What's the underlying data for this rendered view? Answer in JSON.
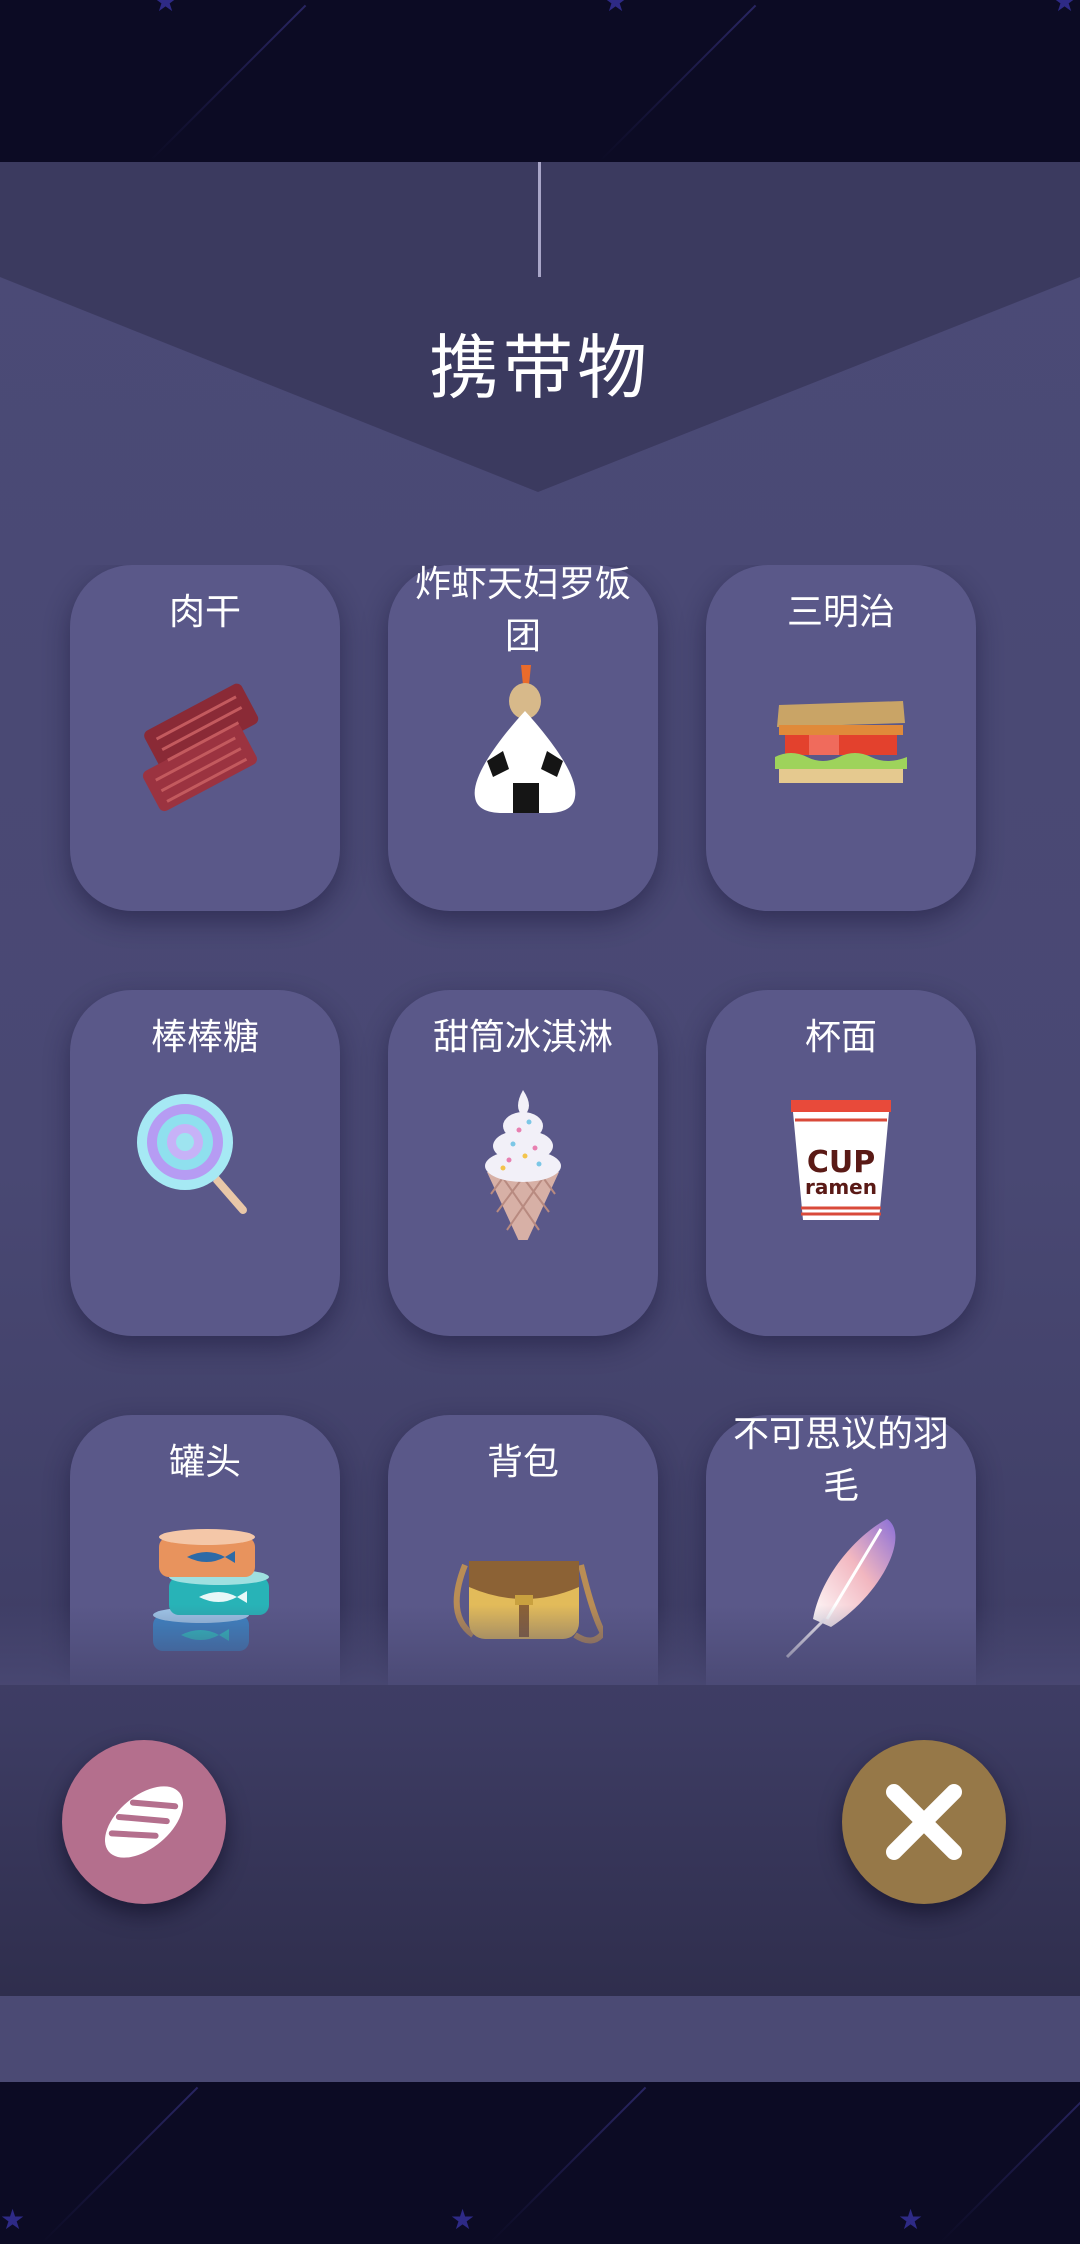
{
  "page": {
    "title": "携带物"
  },
  "items": [
    {
      "label": "肉干",
      "icon": "jerky-icon"
    },
    {
      "label": "炸虾天妇罗饭团",
      "icon": "tempura-onigiri-icon"
    },
    {
      "label": "三明治",
      "icon": "sandwich-icon"
    },
    {
      "label": "棒棒糖",
      "icon": "lollipop-icon"
    },
    {
      "label": "甜筒冰淇淋",
      "icon": "ice-cream-cone-icon"
    },
    {
      "label": "杯面",
      "icon": "cup-ramen-icon",
      "icon_text": [
        "CUP",
        "ramen"
      ]
    },
    {
      "label": "罐头",
      "icon": "canned-fish-icon"
    },
    {
      "label": "背包",
      "icon": "bag-icon"
    },
    {
      "label": "不可思议的羽毛",
      "icon": "feather-icon"
    }
  ],
  "buttons": {
    "left": {
      "icon": "feather-badge-icon",
      "color": "#b46f8d"
    },
    "right": {
      "icon": "close-icon",
      "color": "#967848"
    }
  },
  "colors": {
    "panel": "#4b4a76",
    "card": "#5a5889",
    "sky": "#0c0b24"
  }
}
